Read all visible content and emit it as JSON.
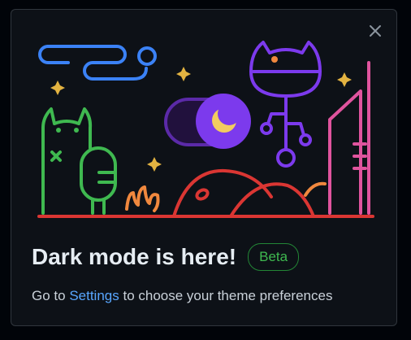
{
  "dialog": {
    "title": "Dark mode is here!",
    "badge": "Beta",
    "description": {
      "prefix": "Go to ",
      "link": "Settings",
      "suffix": " to choose your theme preferences"
    },
    "close_icon": "close-icon"
  },
  "illustration": {
    "theme_toggle_state": "dark"
  },
  "colors": {
    "background": "#0d1117",
    "border": "#30363d",
    "title": "#e6edf3",
    "text": "#c9d1d9",
    "link": "#58a6ff",
    "badge": "#3fb950",
    "illustration_blue": "#3b82f6",
    "illustration_green": "#3fb950",
    "illustration_purple": "#7c3aed",
    "illustration_pink": "#e0549e",
    "illustration_red": "#da3633",
    "illustration_orange": "#f0883e",
    "illustration_yellow": "#e3b341"
  }
}
